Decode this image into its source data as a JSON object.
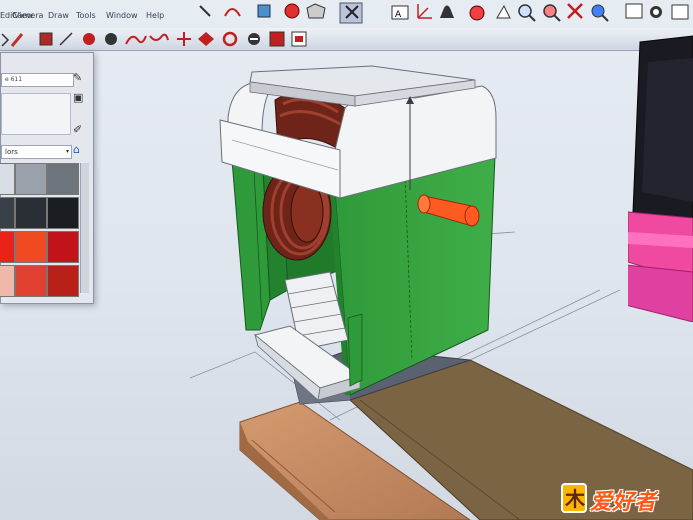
{
  "menubar": {
    "items": [
      "Edit",
      "View",
      "Camera",
      "Draw",
      "Tools",
      "Window",
      "Help"
    ]
  },
  "toolbar_top": {
    "icons": [
      "pencil-icon",
      "brush-icon",
      "rectangle-icon",
      "circle-icon",
      "arc-icon",
      "polygon-icon",
      "freehand-icon",
      "push-pull-icon",
      "move-icon",
      "rotate-icon",
      "follow-me-icon",
      "scale-icon",
      "offset-icon",
      "tape-measure-icon",
      "select-icon",
      "text-icon",
      "axes-icon",
      "dimension-icon",
      "protractor-icon",
      "orbit-icon",
      "pan-icon",
      "zoom-icon",
      "zoom-window-icon",
      "zoom-extents-icon",
      "previous-view-icon",
      "component-icon"
    ]
  },
  "materials_panel": {
    "name_field": "e 611",
    "select_value": "lors",
    "select_caret": "▾",
    "swatch_colors": [
      "#d8dde4",
      "#9aa1aa",
      "#6e747c",
      "#3a4048",
      "#2a2f36",
      "#1a1d22",
      "#e8231a",
      "#f04a22",
      "#c0141a",
      "#f0b8a8",
      "#e04030",
      "#b82018"
    ]
  },
  "watermark": {
    "text": "爱好者",
    "logo_char": "木",
    "logo_color": "#ffb400",
    "text_color": "#ff5a14"
  },
  "colors": {
    "model_green": "#2f9a3a",
    "model_green_dark": "#1f7a2a",
    "model_white": "#f2f4f6",
    "coil_brown": "#7a2a1e",
    "shaft_orange": "#ff5a22",
    "wood_light": "#c8906a",
    "wood_dark": "#7a6444",
    "magenta": "#f04aa0"
  }
}
